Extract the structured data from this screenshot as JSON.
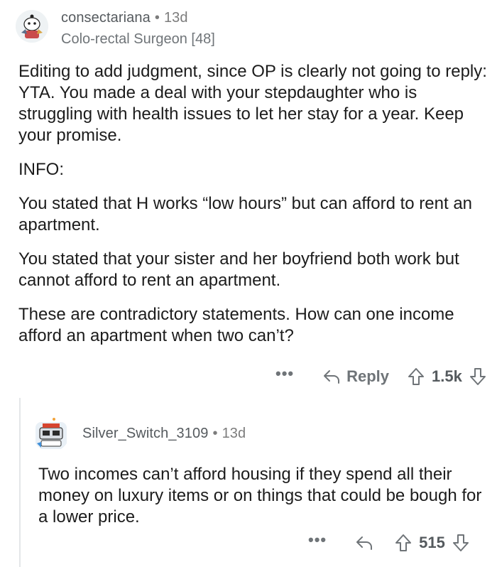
{
  "comments": [
    {
      "username": "consectariana",
      "age": "13d",
      "flair": "Colo-rectal Surgeon [48]",
      "paragraphs": [
        "Editing to add judgment, since OP is clearly not going to reply: YTA. You made a deal with your stepdaughter who is struggling with health issues to let her stay for a year. Keep your promise.",
        "INFO:",
        "You stated that H works “low hours” but can afford to rent an apartment.",
        "You stated that your sister and her boyfriend both work but cannot afford to rent an apartment.",
        "These are contradictory statements. How can one income afford an apartment when two can’t?"
      ],
      "actions": {
        "more": "•••",
        "reply": "Reply",
        "score": "1.5k"
      }
    },
    {
      "username": "Silver_Switch_3109",
      "age": "13d",
      "paragraphs": [
        "Two incomes can’t afford housing if they spend all their money on luxury items or on things that could be bough for a lower price."
      ],
      "actions": {
        "more": "•••",
        "score": "515"
      }
    }
  ],
  "separator": "•",
  "colors": {
    "text": "#1c1c1c",
    "meta": "#7c7c7c",
    "thread_line": "#e4e6e8"
  }
}
